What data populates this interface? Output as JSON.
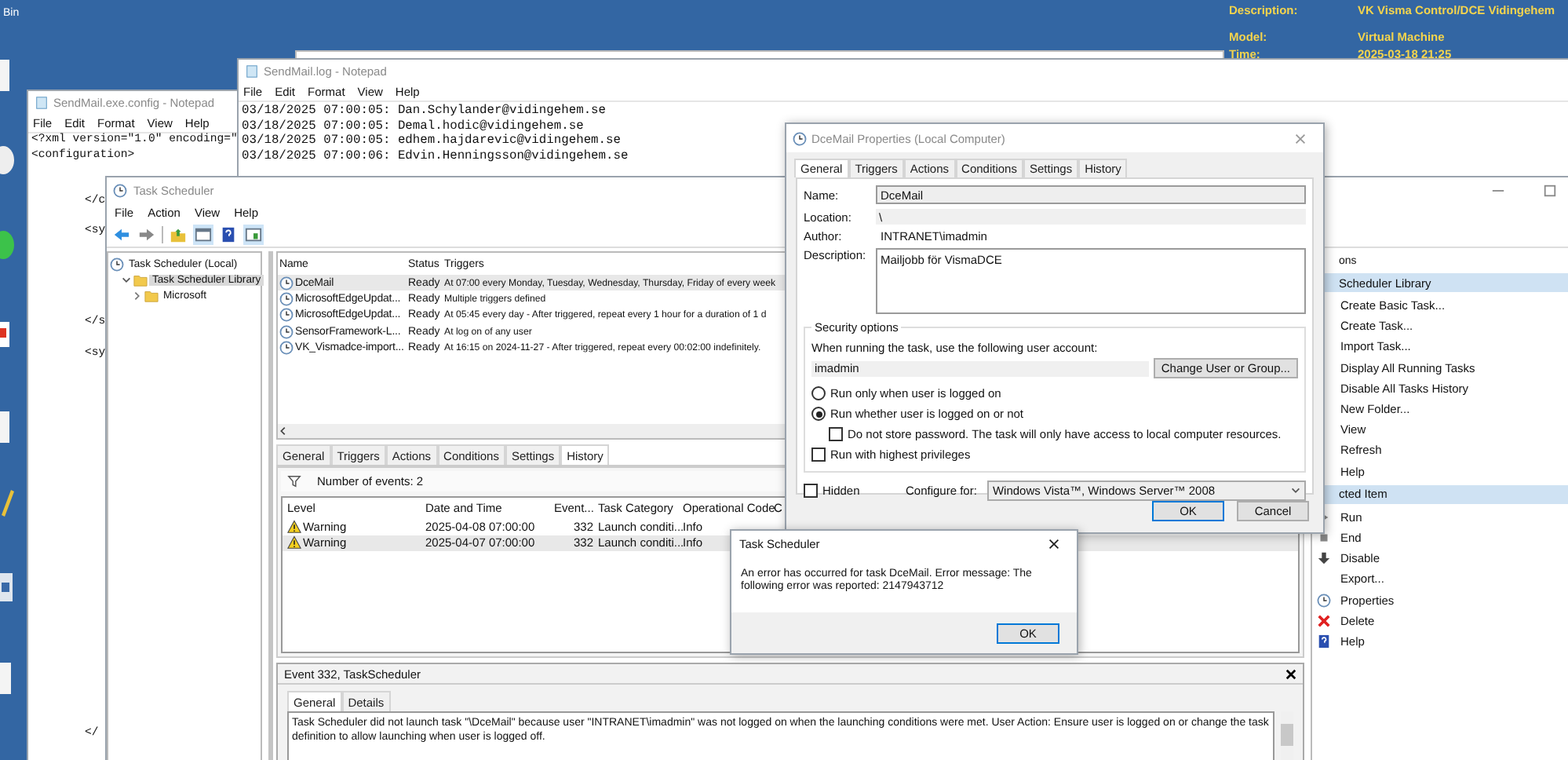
{
  "desktop": {
    "recycle_label": "Bin",
    "info": [
      {
        "label": "Description:",
        "value": "VK Visma Control/DCE Vidingehem"
      },
      {
        "label": "Model:",
        "value": "Virtual Machine"
      },
      {
        "label": "Time:",
        "value": "2025-03-18 21:25"
      }
    ]
  },
  "config_notepad": {
    "title": "SendMail.exe.config - Notepad",
    "menu": [
      "File",
      "Edit",
      "Format",
      "View",
      "Help"
    ],
    "lines": [
      "<?xml version=\"1.0\" encoding=\"",
      "<configuration>",
      "</c",
      "<sy",
      "</s",
      "<sy",
      "</"
    ]
  },
  "log_notepad": {
    "title": "SendMail.log - Notepad",
    "menu": [
      "File",
      "Edit",
      "Format",
      "View",
      "Help"
    ],
    "lines": [
      "03/18/2025 07:00:05: Dan.Schylander@vidingehem.se",
      "03/18/2025 07:00:05: Demal.hodic@vidingehem.se",
      "03/18/2025 07:00:05: edhem.hajdarevic@vidingehem.se",
      "03/18/2025 07:00:06: Edvin.Henningsson@vidingehem.se"
    ]
  },
  "task_scheduler": {
    "title": "Task Scheduler",
    "menu": [
      "File",
      "Action",
      "View",
      "Help"
    ],
    "tree": [
      {
        "label": "Task Scheduler (Local)",
        "selected": false,
        "children": [
          {
            "label": "Task Scheduler Library",
            "selected": true,
            "expanded": true,
            "children": [
              {
                "label": "Microsoft",
                "selected": false,
                "expanded": false
              }
            ]
          }
        ]
      }
    ],
    "tasks": {
      "columns": [
        "Name",
        "Status",
        "Triggers"
      ],
      "rows": [
        {
          "name": "DceMail",
          "status": "Ready",
          "triggers": "At 07:00 every Monday, Tuesday, Wednesday, Thursday, Friday of every week",
          "selected": true
        },
        {
          "name": "MicrosoftEdgeUpdat...",
          "status": "Ready",
          "triggers": "Multiple triggers defined",
          "selected": false
        },
        {
          "name": "MicrosoftEdgeUpdat...",
          "status": "Ready",
          "triggers": "At 05:45 every day - After triggered, repeat every 1 hour for a duration of 1 d",
          "selected": false
        },
        {
          "name": "SensorFramework-L...",
          "status": "Ready",
          "triggers": "At log on of any user",
          "selected": false
        },
        {
          "name": "VK_Vismadce-import...",
          "status": "Ready",
          "triggers": "At 16:15 on 2024-11-27 - After triggered, repeat every 00:02:00 indefinitely.",
          "selected": false
        }
      ]
    },
    "detail_tabs": [
      {
        "label": "General",
        "selected": false
      },
      {
        "label": "Triggers",
        "selected": false
      },
      {
        "label": "Actions",
        "selected": false
      },
      {
        "label": "Conditions",
        "selected": false
      },
      {
        "label": "Settings",
        "selected": false
      },
      {
        "label": "History",
        "selected": true
      }
    ],
    "history": {
      "count": "Number of events: 2",
      "columns": [
        "Level",
        "Date and Time",
        "Event...",
        "Task Category",
        "Operational Code",
        "C"
      ],
      "rows": [
        {
          "level": "Warning",
          "date": "2025-04-08 07:00:00",
          "event_id": "332",
          "category": "Launch conditi...",
          "op_code": "Info",
          "selected": false
        },
        {
          "level": "Warning",
          "date": "2025-04-07 07:00:00",
          "event_id": "332",
          "category": "Launch conditi...",
          "op_code": "Info",
          "selected": true
        }
      ]
    },
    "event": {
      "title": "Event 332, TaskScheduler",
      "tabs": [
        {
          "label": "General",
          "selected": true
        },
        {
          "label": "Details",
          "selected": false
        }
      ],
      "message": "Task Scheduler did not launch task \"\\DceMail\"  because user \"INTRANET\\imadmin\" was not logged on when the launching conditions were met. User Action: Ensure user is logged on or change the task definition to allow launching when user is logged off."
    },
    "actions": [
      {
        "kind": "title",
        "label": "ons"
      },
      {
        "kind": "section",
        "label": "Scheduler Library"
      },
      {
        "kind": "plain",
        "label": "Create Basic Task..."
      },
      {
        "kind": "plain",
        "label": "Create Task..."
      },
      {
        "kind": "plain",
        "label": "Import Task..."
      },
      {
        "kind": "plain",
        "label": "Display All Running Tasks"
      },
      {
        "kind": "plain",
        "label": "Disable All Tasks History"
      },
      {
        "kind": "plain",
        "label": "New Folder..."
      },
      {
        "kind": "plain",
        "label": "View"
      },
      {
        "kind": "plain",
        "label": "Refresh"
      },
      {
        "kind": "plain",
        "label": "Help"
      },
      {
        "kind": "section",
        "label": "cted Item"
      },
      {
        "kind": "run",
        "label": "Run"
      },
      {
        "kind": "end",
        "label": "End"
      },
      {
        "kind": "disable",
        "label": "Disable"
      },
      {
        "kind": "export",
        "label": "Export..."
      },
      {
        "kind": "properties",
        "label": "Properties"
      },
      {
        "kind": "delete",
        "label": "Delete"
      },
      {
        "kind": "help",
        "label": "Help"
      }
    ]
  },
  "properties_dialog": {
    "title": "DceMail Properties (Local Computer)",
    "tabs": [
      {
        "label": "General",
        "selected": true
      },
      {
        "label": "Triggers",
        "selected": false
      },
      {
        "label": "Actions",
        "selected": false
      },
      {
        "label": "Conditions",
        "selected": false
      },
      {
        "label": "Settings",
        "selected": false
      },
      {
        "label": "History",
        "selected": false
      }
    ],
    "name_label": "Name:",
    "name": "DceMail",
    "location_label": "Location:",
    "location": "\\",
    "author_label": "Author:",
    "author": "INTRANET\\imadmin",
    "description_label": "Description:",
    "description": "Mailjobb för VismaDCE",
    "security_title": "Security options",
    "account_prompt": "When running the task, use the following user account:",
    "account": "imadmin",
    "change_button": "Change User or Group...",
    "run_options": [
      {
        "label": "Run only when user is logged on",
        "selected": false
      },
      {
        "label": "Run whether user is logged on or not",
        "selected": true
      }
    ],
    "no_password": {
      "label": "Do not store password.  The task will only have access to local computer resources.",
      "checked": false
    },
    "highest": {
      "label": "Run with highest privileges",
      "checked": false
    },
    "hidden": {
      "label": "Hidden",
      "checked": false
    },
    "configure_label": "Configure for:",
    "configure": "Windows Vista™, Windows Server™ 2008",
    "buttons": [
      "OK",
      "Cancel"
    ]
  },
  "error_dialog": {
    "title": "Task Scheduler",
    "message": "An error has occurred for task DceMail. Error message: The following error was reported: 2147943712",
    "button": "OK"
  }
}
